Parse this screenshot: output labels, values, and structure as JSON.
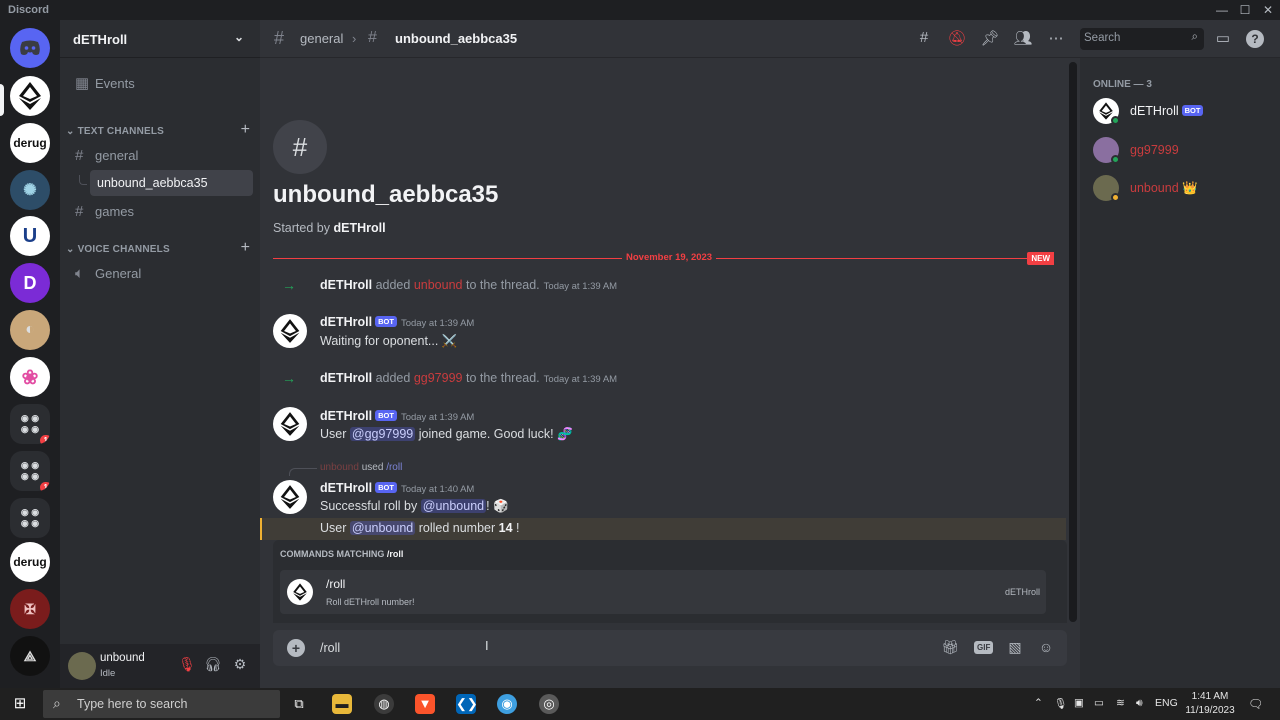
{
  "window": {
    "app_title": "Discord",
    "minimize": "—",
    "maximize": "☐",
    "close": "✕"
  },
  "guilds": [
    {
      "name": "Home",
      "label": ""
    },
    {
      "name": "dETHroll",
      "label": ""
    },
    {
      "name": "derug",
      "label": "derug"
    },
    {
      "name": "server-3",
      "label": ""
    },
    {
      "name": "server-4",
      "label": ""
    },
    {
      "name": "server-5",
      "label": ""
    },
    {
      "name": "server-6",
      "label": ""
    },
    {
      "name": "server-7",
      "label": ""
    },
    {
      "name": "folder-1",
      "label": "",
      "badge": "1"
    },
    {
      "name": "folder-2",
      "label": "",
      "badge": "1"
    },
    {
      "name": "folder-3",
      "label": ""
    },
    {
      "name": "derug-2",
      "label": "derug"
    },
    {
      "name": "server-8",
      "label": ""
    },
    {
      "name": "server-9",
      "label": ""
    }
  ],
  "server": {
    "name": "dETHroll"
  },
  "sidebar": {
    "events_label": "Events",
    "text_category": "TEXT CHANNELS",
    "voice_category": "VOICE CHANNELS",
    "text_channels": [
      "general",
      "games"
    ],
    "active_thread": "unbound_aebbca35",
    "voice_channels": [
      "General"
    ]
  },
  "user_panel": {
    "name": "unbound",
    "status": "Idle"
  },
  "header": {
    "parent_channel": "general",
    "separator": "›",
    "thread_name": "unbound_aebbca35",
    "search_placeholder": "Search"
  },
  "thread": {
    "title": "unbound_aebbca35",
    "started_prefix": "Started by",
    "started_by": "dETHroll",
    "divider_date": "November 19, 2023",
    "new_label": "NEW"
  },
  "messages": {
    "sys1": {
      "actor": "dETHroll",
      "verb": "added",
      "target": "unbound",
      "rest": "to the thread.",
      "time": "Today at 1:39 AM"
    },
    "m1": {
      "author": "dETHroll",
      "badge": "BOT",
      "time": "Today at 1:39 AM",
      "text": "Waiting for oponent... ⚔️"
    },
    "sys2": {
      "actor": "dETHroll",
      "verb": "added",
      "target": "gg97999",
      "rest": "to the thread.",
      "time": "Today at 1:39 AM"
    },
    "m2": {
      "author": "dETHroll",
      "badge": "BOT",
      "time": "Today at 1:39 AM",
      "pre": "User",
      "mention": "@gg97999",
      "post": "joined game. Good luck! 🧬"
    },
    "reply": {
      "user": "unbound",
      "verb": "used",
      "command": "/roll"
    },
    "m3": {
      "author": "dETHroll",
      "badge": "BOT",
      "time": "Today at 1:40 AM",
      "line1_pre": "Successful roll by",
      "line1_mention": "@unbound",
      "line1_post": "! 🎲",
      "line2_pre": "User",
      "line2_mention": "@unbound",
      "line2_mid": "rolled number",
      "line2_num": "14",
      "line2_post": "!"
    }
  },
  "autocomplete": {
    "header_prefix": "COMMANDS MATCHING",
    "query": "/roll",
    "command": "/roll",
    "description": "Roll dETHroll number!",
    "source": "dETHroll"
  },
  "composer": {
    "value": "/roll",
    "gif_label": "GIF"
  },
  "members": {
    "heading": "ONLINE — 3",
    "list": [
      {
        "name": "dETHroll",
        "badge": "BOT",
        "color": "#f2f3f5"
      },
      {
        "name": "gg97999",
        "color": "#c93c3e"
      },
      {
        "name": "unbound",
        "suffix": "👑",
        "color": "#c93c3e"
      }
    ]
  },
  "taskbar": {
    "search_placeholder": "Type here to search",
    "lang": "ENG",
    "time": "1:41 AM",
    "date": "11/19/2023"
  },
  "colors": {
    "accent": "#5865f2",
    "danger": "#f23f43",
    "online": "#23a55a"
  }
}
